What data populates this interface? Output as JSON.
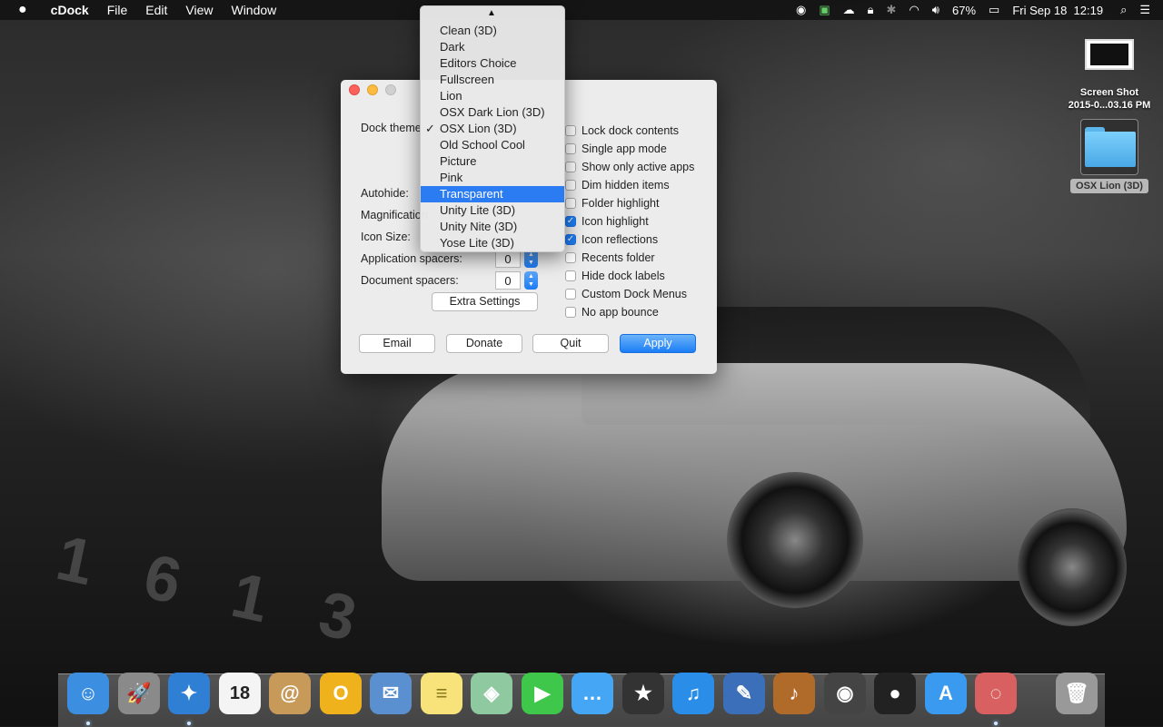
{
  "menubar": {
    "apple_icon": "apple-logo",
    "app_name": "cDock",
    "menus": [
      "File",
      "Edit",
      "View",
      "Window"
    ],
    "battery": "67%",
    "datetime": "Fri Sep 18  12:19"
  },
  "window": {
    "dock_theme_label": "Dock theme",
    "autohide_label": "Autohide:",
    "magnification_label": "Magnification",
    "icon_size_label": "Icon Size:",
    "app_spacers_label": "Application spacers:",
    "app_spacers_value": "0",
    "doc_spacers_label": "Document spacers:",
    "doc_spacers_value": "0",
    "extra_settings": "Extra Settings",
    "checkboxes": [
      {
        "label": "Lock dock contents",
        "checked": false
      },
      {
        "label": "Single app mode",
        "checked": false
      },
      {
        "label": "Show only active apps",
        "checked": false
      },
      {
        "label": "Dim hidden items",
        "checked": false
      },
      {
        "label": "Folder highlight",
        "checked": false
      },
      {
        "label": "Icon highlight",
        "checked": true
      },
      {
        "label": "Icon reflections",
        "checked": true
      },
      {
        "label": "Recents folder",
        "checked": false
      },
      {
        "label": "Hide dock labels",
        "checked": false
      },
      {
        "label": "Custom Dock Menus",
        "checked": false
      },
      {
        "label": "No app bounce",
        "checked": false
      }
    ],
    "buttons": {
      "email": "Email",
      "donate": "Donate",
      "quit": "Quit",
      "apply": "Apply"
    }
  },
  "theme_menu": {
    "items": [
      "Clean (3D)",
      "Dark",
      "Editors Choice",
      "Fullscreen",
      "Lion",
      "OSX Dark Lion (3D)",
      "OSX Lion (3D)",
      "Old School Cool",
      "Picture",
      "Pink",
      "Transparent",
      "Unity Lite (3D)",
      "Unity Nite (3D)",
      "Yose Lite (3D)"
    ],
    "checked_item": "OSX Lion (3D)",
    "highlighted_item": "Transparent"
  },
  "desktop": {
    "screenshot_label_line1": "Screen Shot",
    "screenshot_label_line2": "2015-0...03.16 PM",
    "folder_label": "OSX Lion (3D)"
  },
  "dock": {
    "apps": [
      {
        "name": "finder-icon",
        "glyph": "☺",
        "color": "#3b8ee0"
      },
      {
        "name": "launchpad-icon",
        "glyph": "🚀",
        "color": "#8a8a8a"
      },
      {
        "name": "safari-icon",
        "glyph": "✦",
        "color": "#2f7fd4"
      },
      {
        "name": "calendar-icon",
        "glyph": "18",
        "color": "#f4f4f4"
      },
      {
        "name": "contacts-icon",
        "glyph": "@",
        "color": "#c79a5a"
      },
      {
        "name": "outlook-icon",
        "glyph": "O",
        "color": "#f0b21c"
      },
      {
        "name": "mail-icon",
        "glyph": "✉",
        "color": "#5a8fd0"
      },
      {
        "name": "notes-icon",
        "glyph": "≡",
        "color": "#f7e37a"
      },
      {
        "name": "maps-icon",
        "glyph": "◈",
        "color": "#8fc9a0"
      },
      {
        "name": "facetime-icon",
        "glyph": "▶",
        "color": "#3fc74b"
      },
      {
        "name": "messages-icon",
        "glyph": "…",
        "color": "#45a6f5"
      },
      {
        "name": "imovie-icon",
        "glyph": "★",
        "color": "#333"
      },
      {
        "name": "itunes-icon",
        "glyph": "♫",
        "color": "#2a8de8"
      },
      {
        "name": "xcode-icon",
        "glyph": "✎",
        "color": "#3c6fb9"
      },
      {
        "name": "garageband-icon",
        "glyph": "♪",
        "color": "#b06a2a"
      },
      {
        "name": "logic-icon",
        "glyph": "◉",
        "color": "#444"
      },
      {
        "name": "vinyl-icon",
        "glyph": "●",
        "color": "#222"
      },
      {
        "name": "app-store-icon",
        "glyph": "A",
        "color": "#3a9af0"
      },
      {
        "name": "photos-icon",
        "glyph": "◌",
        "color": "#d86060"
      },
      {
        "name": "trash-icon",
        "glyph": "🗑",
        "color": "#999"
      }
    ]
  }
}
